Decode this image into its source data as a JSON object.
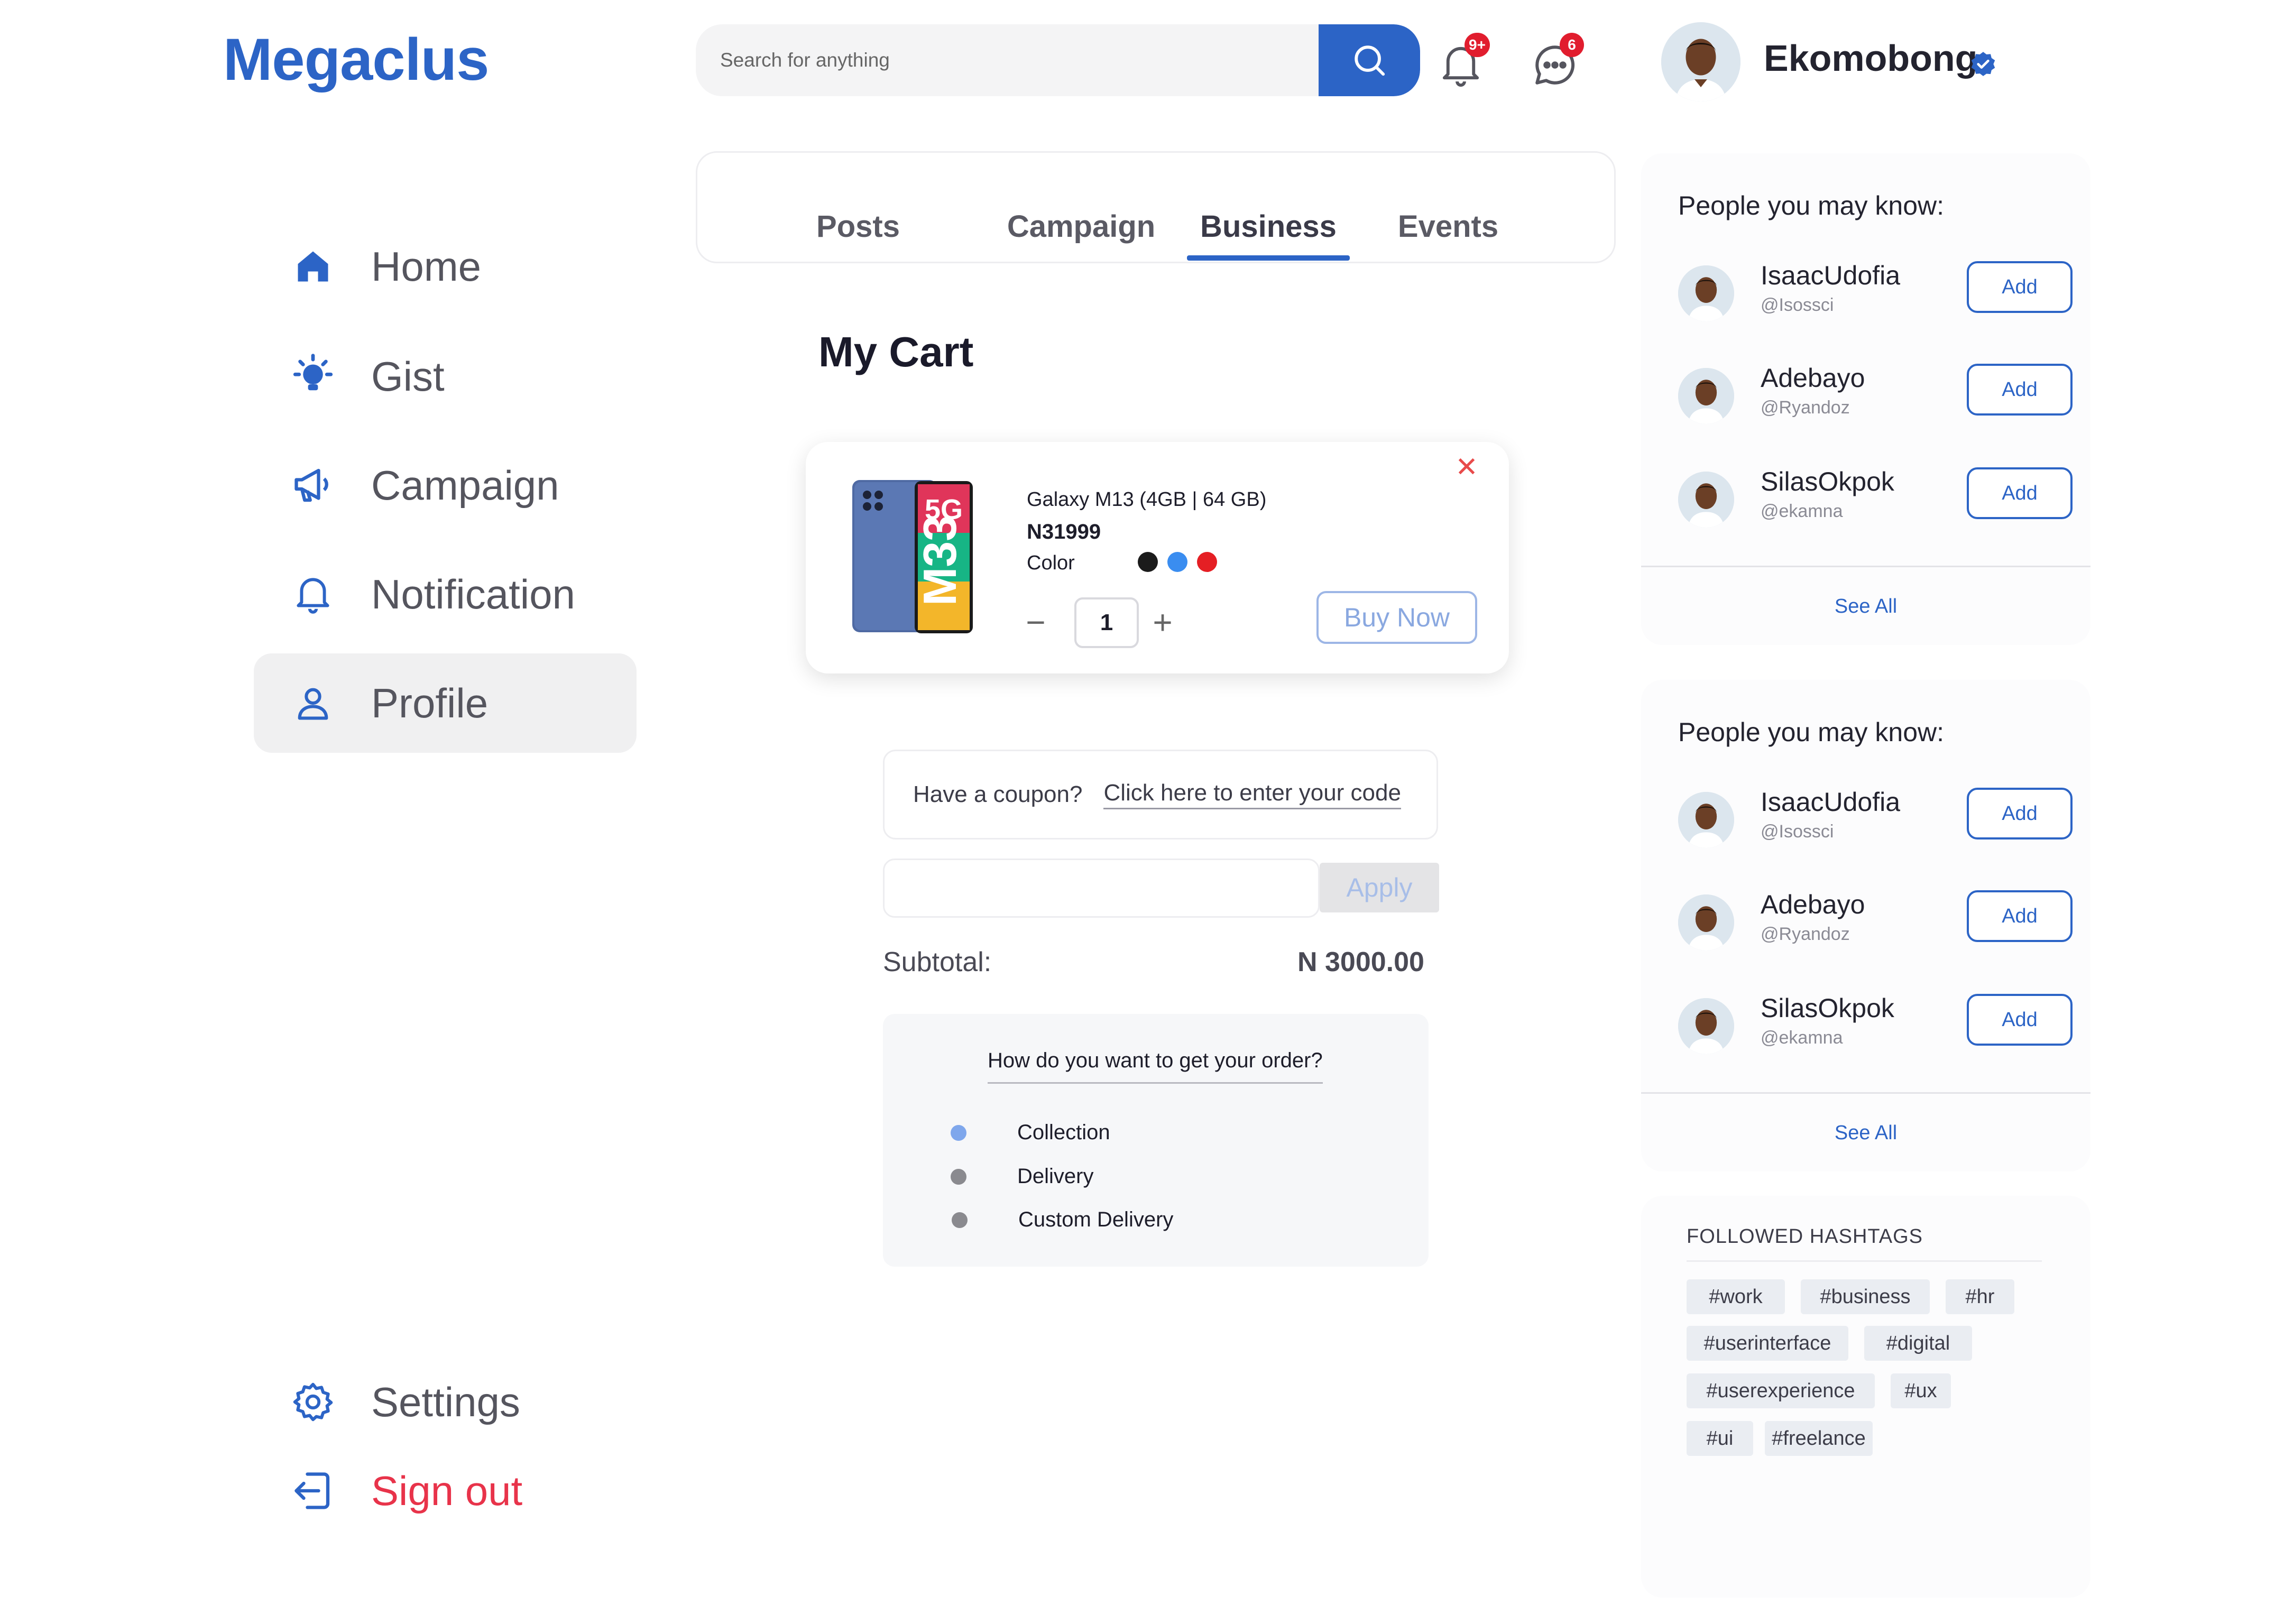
{
  "brand": {
    "logo": "Megaclus",
    "accent": "#2c64c6",
    "danger": "#e8334a"
  },
  "header": {
    "search_placeholder": "Search for anything",
    "notifications_badge": "9+",
    "messages_badge": "6",
    "user_name": "Ekomobong"
  },
  "sidebar": {
    "items": [
      {
        "label": "Home",
        "icon": "home-icon"
      },
      {
        "label": "Gist",
        "icon": "lightbulb-icon"
      },
      {
        "label": "Campaign",
        "icon": "megaphone-icon"
      },
      {
        "label": "Notification",
        "icon": "bell-icon"
      },
      {
        "label": "Profile",
        "icon": "user-icon",
        "active": true
      }
    ],
    "settings_label": "Settings",
    "signout_label": "Sign out"
  },
  "tabs": [
    "Posts",
    "Campaign",
    "Business",
    "Events"
  ],
  "active_tab": "Business",
  "page_title": "My Cart",
  "cart": {
    "product_name": "Galaxy M13 (4GB | 64 GB)",
    "price": "N31999",
    "color_label": "Color",
    "colors": [
      "#1b1b1b",
      "#3a8df0",
      "#e51f24"
    ],
    "quantity": "1",
    "minus": "−",
    "plus": "+",
    "buy_now": "Buy Now",
    "remove": "✕",
    "phone_text": {
      "tag": "5G",
      "model": "M33"
    }
  },
  "coupon": {
    "question": "Have  a coupon?",
    "link": "Click here to enter your code",
    "apply": "Apply"
  },
  "subtotal": {
    "label": "Subtotal:",
    "value": "N 3000.00"
  },
  "delivery": {
    "question": "How do you want to get your order?",
    "options": [
      {
        "label": "Collection",
        "color": "#7fa7ec"
      },
      {
        "label": "Delivery",
        "color": "#8a8a8f"
      },
      {
        "label": "Custom Delivery",
        "color": "#8a8a8f"
      }
    ]
  },
  "suggestions": [
    {
      "title": "People you may know:",
      "people": [
        {
          "name": "IsaacUdofia",
          "handle": "@Isossci",
          "action": "Add"
        },
        {
          "name": "Adebayo",
          "handle": "@Ryandoz",
          "action": "Add"
        },
        {
          "name": "SilasOkpok",
          "handle": "@ekamna",
          "action": "Add"
        }
      ],
      "see_all": "See All"
    },
    {
      "title": "People you may know:",
      "people": [
        {
          "name": "IsaacUdofia",
          "handle": "@Isossci",
          "action": "Add"
        },
        {
          "name": "Adebayo",
          "handle": "@Ryandoz",
          "action": "Add"
        },
        {
          "name": "SilasOkpok",
          "handle": "@ekamna",
          "action": "Add"
        }
      ],
      "see_all": "See All"
    }
  ],
  "hashtags": {
    "title": "FOLLOWED HASHTAGS",
    "tags": [
      "#work",
      "#business",
      "#hr",
      "#userinterface",
      "#digital",
      "#userexperience",
      "#ux",
      "#ui",
      "#freelance"
    ]
  }
}
